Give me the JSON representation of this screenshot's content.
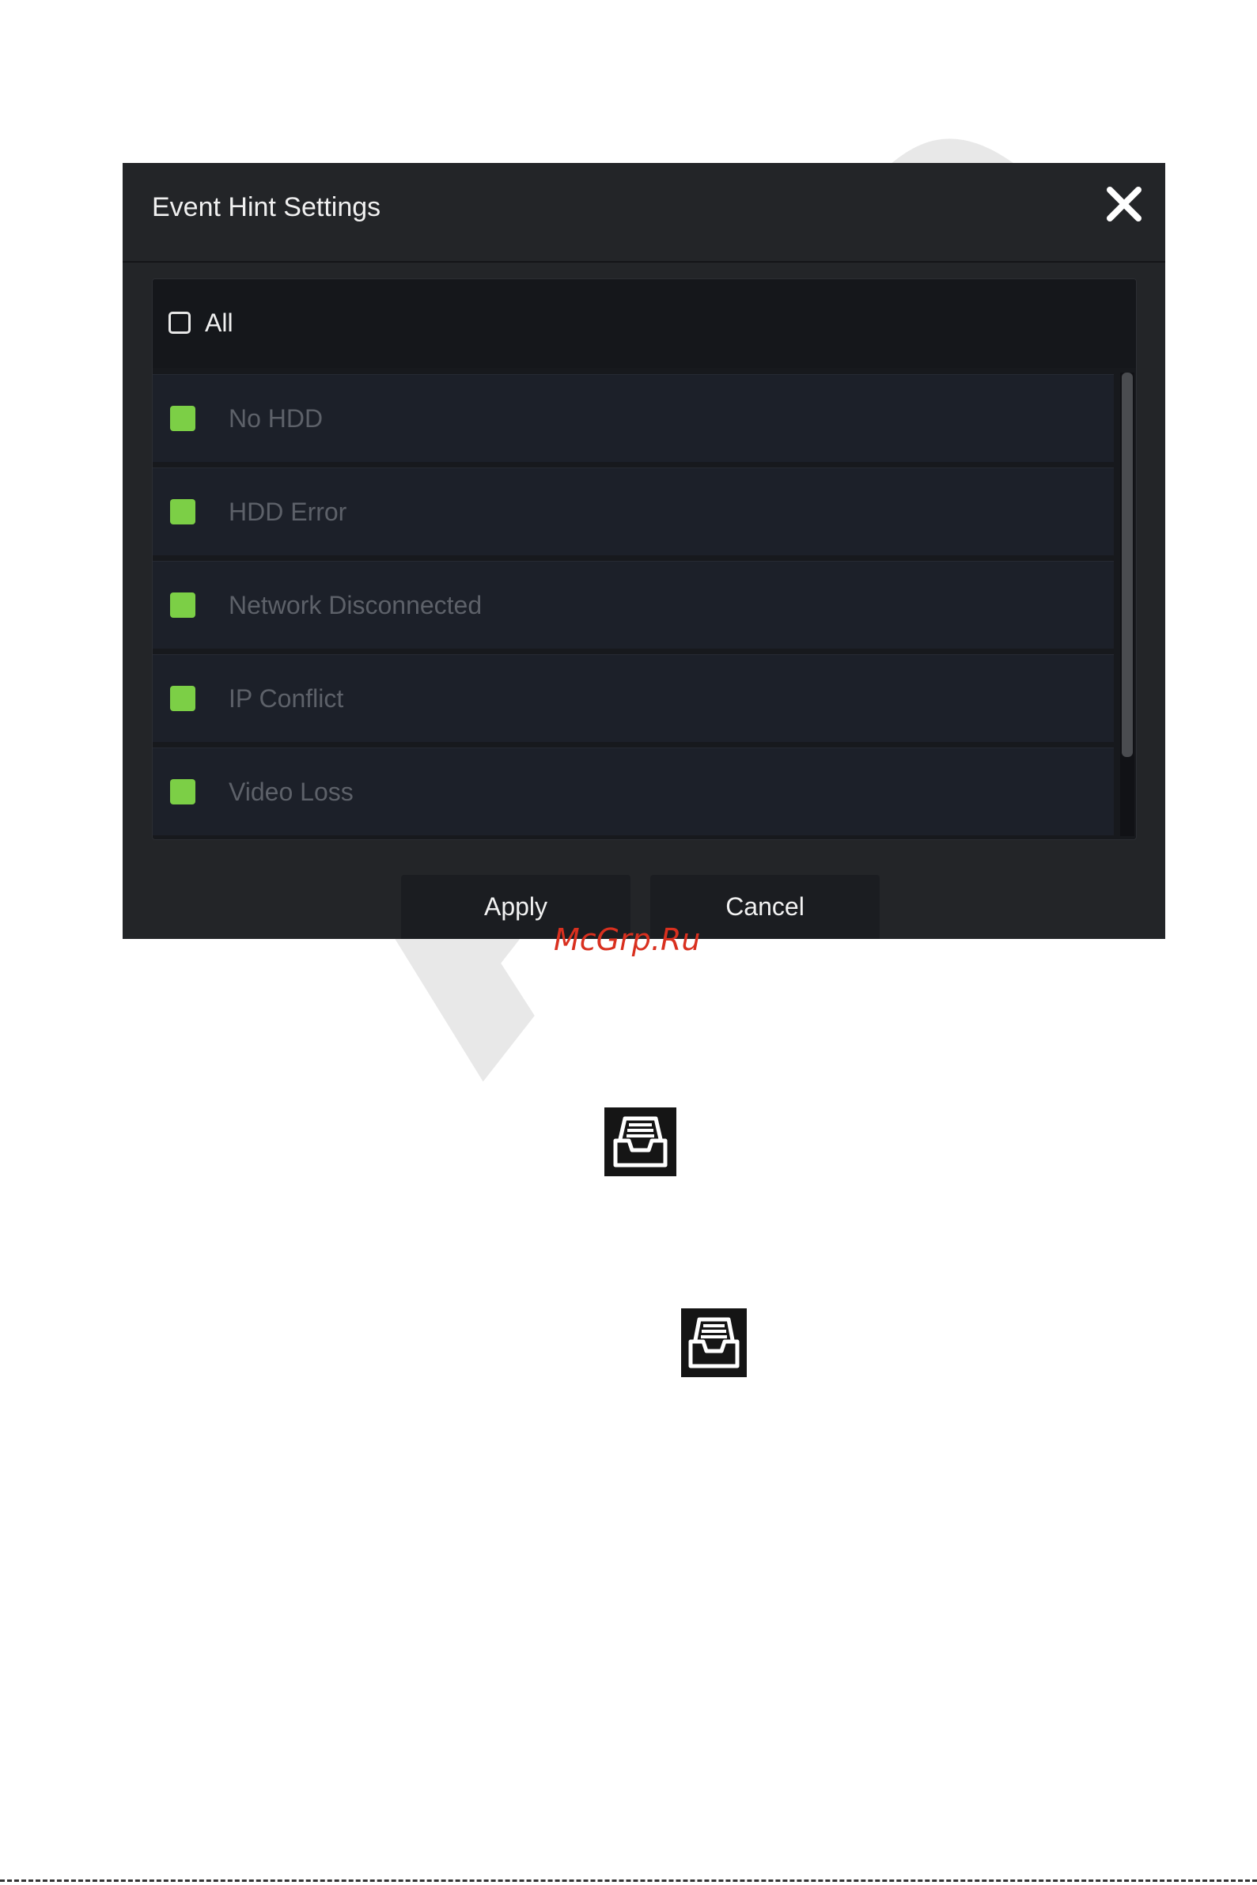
{
  "background_watermark": "Ama",
  "dialog": {
    "title": "Event Hint Settings",
    "close_icon": "close-icon",
    "select_all": {
      "label": "All",
      "checked": false
    },
    "events": [
      {
        "label": "No HDD",
        "checked": true
      },
      {
        "label": "HDD Error",
        "checked": true
      },
      {
        "label": "Network Disconnected",
        "checked": true
      },
      {
        "label": "IP Conflict",
        "checked": true
      },
      {
        "label": "Video Loss",
        "checked": true
      }
    ],
    "apply_label": "Apply",
    "cancel_label": "Cancel"
  },
  "site_watermark": "McGrp.Ru",
  "icons": [
    "archive-icon",
    "archive-icon"
  ],
  "colors": {
    "dialog_bg": "#232528",
    "checked_green": "#7ccf46",
    "watermark_red": "#d9301f"
  }
}
